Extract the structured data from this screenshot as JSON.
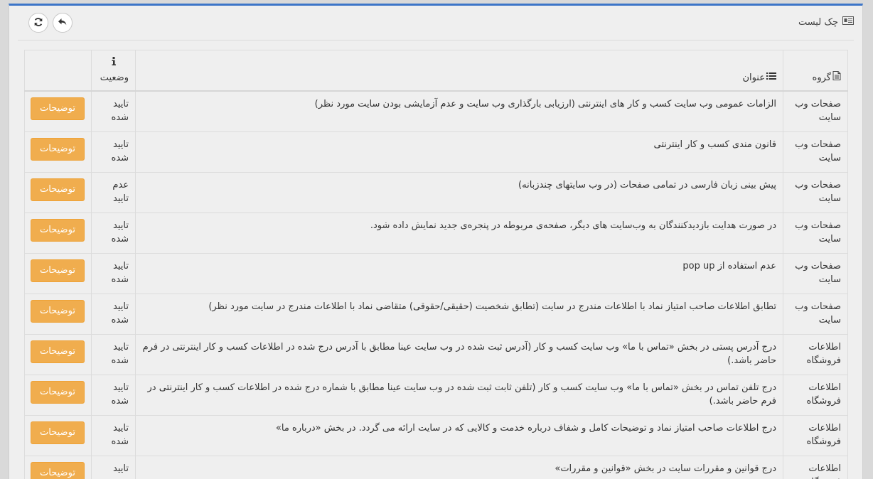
{
  "panel": {
    "title": "چک لیست",
    "accent_color": "#3c75c8",
    "icons": {
      "title": "id-card-icon",
      "refresh": "refresh-icon",
      "back": "reply-icon"
    }
  },
  "table": {
    "headers": {
      "group": "گروه",
      "title": "عنوان",
      "status": "وضعیت",
      "group_icon": "file-text-icon",
      "title_icon": "list-icon",
      "status_icon": "info-icon"
    },
    "button_color": "#f0ad4e",
    "rows": [
      {
        "group": "صفحات وب سایت",
        "title": "الزامات عمومی وب سایت کسب و کار های اینترنتی (ارزیابی بارگذاری وب سایت و عدم آزمایشی بودن سایت مورد نظر)",
        "status": "تایید شده",
        "action": "توضیحات"
      },
      {
        "group": "صفحات وب سایت",
        "title": "قانون مندی کسب و کار اینترنتی",
        "status": "تایید شده",
        "action": "توضیحات"
      },
      {
        "group": "صفحات وب سایت",
        "title": "پیش بینی زبان فارسی در تمامی صفحات (در وب سایتهای چندزبانه)",
        "status": "عدم تایید",
        "action": "توضیحات"
      },
      {
        "group": "صفحات وب سایت",
        "title": "در صورت هدایت بازدیدکنندگان به وب‌سایت های دیگر، صفحه‌ی مربوطه در پنجره‌ی جدید نمایش داده شود.",
        "status": "تایید شده",
        "action": "توضیحات"
      },
      {
        "group": "صفحات وب سایت",
        "title": "عدم استفاده از pop up",
        "status": "تایید شده",
        "action": "توضیحات"
      },
      {
        "group": "صفحات وب سایت",
        "title": "تطابق اطلاعات صاحب امتیاز نماد با اطلاعات مندرج در سایت (تطابق شخصیت (حقیقی/حقوقی) متقاضی نماد با اطلاعات مندرج در سایت مورد نظر)",
        "status": "تایید شده",
        "action": "توضیحات"
      },
      {
        "group": "اطلاعات فروشگاه",
        "title": "درج آدرس پستی در بخش «تماس با ما» وب سایت کسب و کار (آدرس ثبت شده در وب سایت عینا مطابق با آدرس درج شده در اطلاعات کسب و کار اینترنتی در فرم حاضر باشد.)",
        "status": "تایید شده",
        "action": "توضیحات"
      },
      {
        "group": "اطلاعات فروشگاه",
        "title": "درج تلفن تماس در بخش «تماس با ما» وب سایت کسب و کار (تلفن ثابت ثبت شده در وب سایت عینا مطابق با شماره درج شده در اطلاعات کسب و کار اینترنتی در فرم حاضر باشد.)",
        "status": "تایید شده",
        "action": "توضیحات"
      },
      {
        "group": "اطلاعات فروشگاه",
        "title": "درج اطلاعات صاحب امتیاز نماد و توضیحات کامل و شفاف درباره خدمت و کالایی که در سایت ارائه می گردد. در بخش «درباره ما»",
        "status": "تایید شده",
        "action": "توضیحات"
      },
      {
        "group": "اطلاعات فروشگاه",
        "title": "درج قوانین و مقررات سایت در بخش «قوانین و مقررات»",
        "status": "تایید شده",
        "action": "توضیحات"
      }
    ]
  }
}
